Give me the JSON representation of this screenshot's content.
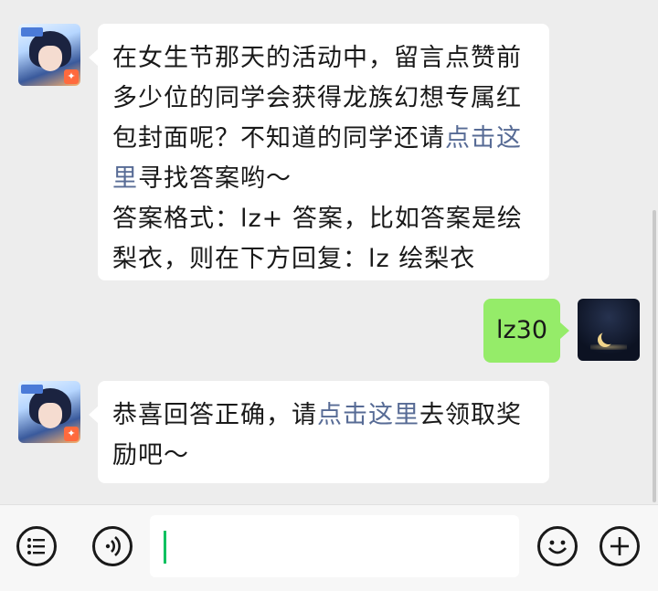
{
  "messages": [
    {
      "side": "left",
      "avatar": "game-character-avatar",
      "segments": [
        {
          "text": "在女生节那天的活动中，留言点赞前多少位的同学会获得龙族幻想专属红包封面呢？不知道的同学还请",
          "link": false
        },
        {
          "text": "点击这里",
          "link": true
        },
        {
          "text": "寻找答案哟～",
          "link": false
        },
        {
          "text": "答案格式：lz+ 答案，比如答案是绘梨衣，则在下方回复：lz 绘梨衣",
          "link": false
        }
      ]
    },
    {
      "side": "right",
      "avatar": "night-moon-avatar",
      "text": "lz30"
    },
    {
      "side": "left",
      "avatar": "game-character-avatar",
      "segments": [
        {
          "text": "恭喜回答正确，请",
          "link": false
        },
        {
          "text": "点击这里",
          "link": true
        },
        {
          "text": "去领取奖励吧～",
          "link": false
        }
      ]
    }
  ],
  "input_bar": {
    "left_icons": [
      "menu-list-icon",
      "voice-icon"
    ],
    "input_value": "",
    "right_icons": [
      "emoji-icon",
      "plus-icon"
    ]
  },
  "colors": {
    "background": "#ededed",
    "bubble_in": "#ffffff",
    "bubble_out": "#95ec69",
    "link": "#576b95",
    "cursor": "#07c160"
  }
}
